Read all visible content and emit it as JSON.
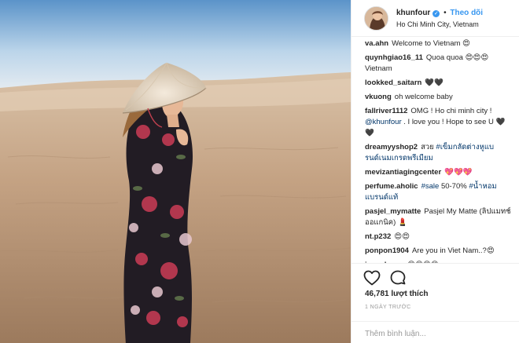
{
  "post": {
    "photo": {
      "name": "woman-in-ao-dai-on-sand-dunes"
    },
    "header": {
      "username": "khunfour",
      "verified_icon": "verified-badge-icon",
      "separator": "•",
      "follow_label": "Theo dõi",
      "location": "Ho Chi Minh City, Vietnam"
    },
    "comments": [
      {
        "user": "va.ahn",
        "text": "Welcome to Vietnam 😍"
      },
      {
        "user": "quynhgiao16_11",
        "text": "Quoa quoa 😍😍😍 Vietnam"
      },
      {
        "user": "lookked_saitarn",
        "text": "🖤🖤"
      },
      {
        "user": "vkuong",
        "text": "oh welcome baby"
      },
      {
        "user": "fallriver1112",
        "text": "OMG ! Ho chi minh city !",
        "mention": "@khunfour",
        "text2": ". I love you ! Hope to see U 🖤🖤"
      },
      {
        "user": "dreamyyshop2",
        "text": "สวย",
        "tag": "#เข็มกลัดต่างหูแบรนด์เนมเกรดพรีเมียม"
      },
      {
        "user": "mevizantiagingcenter",
        "text": "💖💖💖"
      },
      {
        "user": "perfume.aholic",
        "tag": "#sale",
        "text": "50-70%",
        "tag2": "#น้ำหอมแบรนด์แท้"
      },
      {
        "user": "pasjel_mymatte",
        "text": "Pasjel My Matte (ลิปแมทช์ออแกนิค) 💄"
      },
      {
        "user": "nt.p232",
        "text": "😍😍"
      },
      {
        "user": "ponpon1904",
        "text": "Are you in Viet Nam..?😍"
      },
      {
        "user": "iang_korea",
        "text": "😍😍😍😍"
      }
    ],
    "actions": {
      "like_icon": "heart-icon",
      "comment_icon": "comment-bubble-icon",
      "likes": "46,781 lượt thích",
      "time": "1 NGÀY TRƯỚC",
      "comment_placeholder": "Thêm bình luận..."
    }
  }
}
